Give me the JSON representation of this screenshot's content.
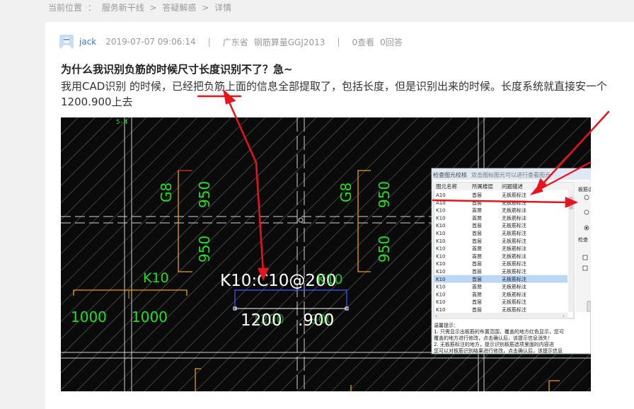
{
  "breadcrumb": {
    "prefix": "当前位置",
    "colon": "：",
    "items": [
      "服务新干线",
      "答疑解惑",
      "详情"
    ],
    "separator": ">"
  },
  "post": {
    "user": "jack",
    "datetime": "2019-07-07 09:06:14",
    "province": "广东省",
    "product": "钢筋算量GGJ2013",
    "views": "0查看",
    "answers": "0回答",
    "meta_sep": "|",
    "title": "为什么我识别负筋的时候尺寸长度识别不了？急~",
    "body": "我用CAD识别 的时候，已经把负筋上面的信息全部提取了，包括长度，但是识别出来的时候。长度系统就直接安一个1200.900上去"
  },
  "cad": {
    "axis_label": "5-4",
    "labels": {
      "g8_left": "G8",
      "g8_right": "G8",
      "n950_a": "950",
      "n950_b": "950",
      "n950_c": "950",
      "n950_d": "950",
      "k10": "K10",
      "k10_spec": "K10:C10@200",
      "k10_overlay": "K10",
      "n1000_a": "1000",
      "n1000_b": "1000",
      "n1200": "1200",
      "n900": ".900",
      "n1200_dup": "1200",
      "n900_dup": "900"
    },
    "dialog": {
      "title_a": "检查图元校核",
      "title_b": "双击图标图元可以进行查看图元",
      "columns": [
        "图元名称",
        "所属楼层",
        "问题描述"
      ],
      "rows": [
        [
          "A10",
          "首层",
          "无板筋标注"
        ],
        [
          "A10",
          "首层",
          "无板筋标注"
        ],
        [
          "K10",
          "首层",
          "无板筋标注"
        ],
        [
          "K10",
          "首层",
          "无板筋标注"
        ],
        [
          "K10",
          "首层",
          "无板筋标注"
        ],
        [
          "K10",
          "首层",
          "无板筋标注"
        ],
        [
          "K10",
          "首层",
          "无板筋标注"
        ],
        [
          "K10",
          "首层",
          "无板筋标注"
        ],
        [
          "K10",
          "首层",
          "无板筋标注"
        ],
        [
          "K10",
          "首层",
          "无板筋标注"
        ],
        [
          "K10",
          "首层",
          "无板筋标注"
        ],
        [
          "K10",
          "首层",
          "无板筋标注"
        ],
        [
          "K10",
          "首层",
          "无板筋标注"
        ],
        [
          "K10",
          "首层",
          "无板筋标注"
        ],
        [
          "K10",
          "首层",
          "无板筋标注"
        ],
        [
          "K10",
          "首层",
          "无板筋标注"
        ]
      ],
      "selected_row": 11,
      "tips_title": "温馨提示：",
      "tips": [
        "1. 只需显示出板筋的布置范围，覆盖的地方红色显示，您可",
        "覆盖的地方进行修改，点击确认后，该提示信息消失！",
        "2. 无板筋标注的地方，提示识别板筋选项里面的内容进",
        "您可以对板筋识别结果进行修改，点击确认后，该提示信息"
      ],
      "side_panel_title": "板筋识",
      "side_panel_label": "检查"
    }
  },
  "colors": {
    "accent_link": "#3a79c4",
    "cad_green": "#22e01c",
    "cad_white": "#ffffff",
    "cad_orange": "#e8a100",
    "annotation_red": "#e8141b"
  }
}
